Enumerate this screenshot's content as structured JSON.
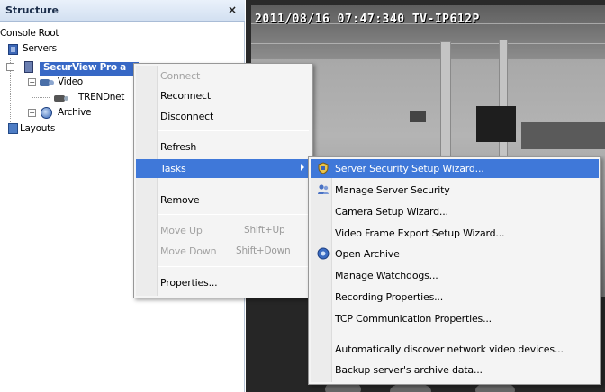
{
  "structure_panel": {
    "title": "Structure",
    "close_label": "×",
    "tree": {
      "root_label": "Console Root",
      "servers_label": "Servers",
      "server_label": "SecurView Pro a",
      "video_label": "Video",
      "camera_label": "TRENDnet",
      "archive_label": "Archive",
      "layouts_label": "Layouts"
    }
  },
  "video": {
    "osd_text": "2011/08/16 07:47:340 TV-IP612P"
  },
  "context_menu": {
    "items": [
      {
        "label": "Connect",
        "enabled": false
      },
      {
        "label": "Reconnect",
        "enabled": true
      },
      {
        "label": "Disconnect",
        "enabled": true
      },
      {
        "label": "Refresh",
        "enabled": true
      },
      {
        "label": "Tasks",
        "enabled": true,
        "highlighted": true
      },
      {
        "label": "Remove",
        "enabled": true
      },
      {
        "label": "Move Up",
        "shortcut": "Shift+Up",
        "enabled": false
      },
      {
        "label": "Move Down",
        "shortcut": "Shift+Down",
        "enabled": false
      },
      {
        "label": "Properties...",
        "enabled": true
      }
    ]
  },
  "tasks_submenu": {
    "items": [
      {
        "label": "Server Security Setup Wizard...",
        "icon": "shield-wizard-icon",
        "highlighted": true
      },
      {
        "label": "Manage Server Security",
        "icon": "security-users-icon"
      },
      {
        "label": "Camera Setup Wizard..."
      },
      {
        "label": "Video Frame Export Setup Wizard..."
      },
      {
        "label": "Open Archive",
        "icon": "archive-icon"
      },
      {
        "label": "Manage Watchdogs..."
      },
      {
        "label": "Recording Properties..."
      },
      {
        "label": "TCP Communication Properties..."
      },
      {
        "label": "Automatically discover network video devices..."
      },
      {
        "label": "Backup server's archive data..."
      }
    ]
  },
  "colors": {
    "menu_highlight": "#3f78d9",
    "tree_selection": "#3768c6",
    "disabled_text": "#a3a3a3"
  }
}
